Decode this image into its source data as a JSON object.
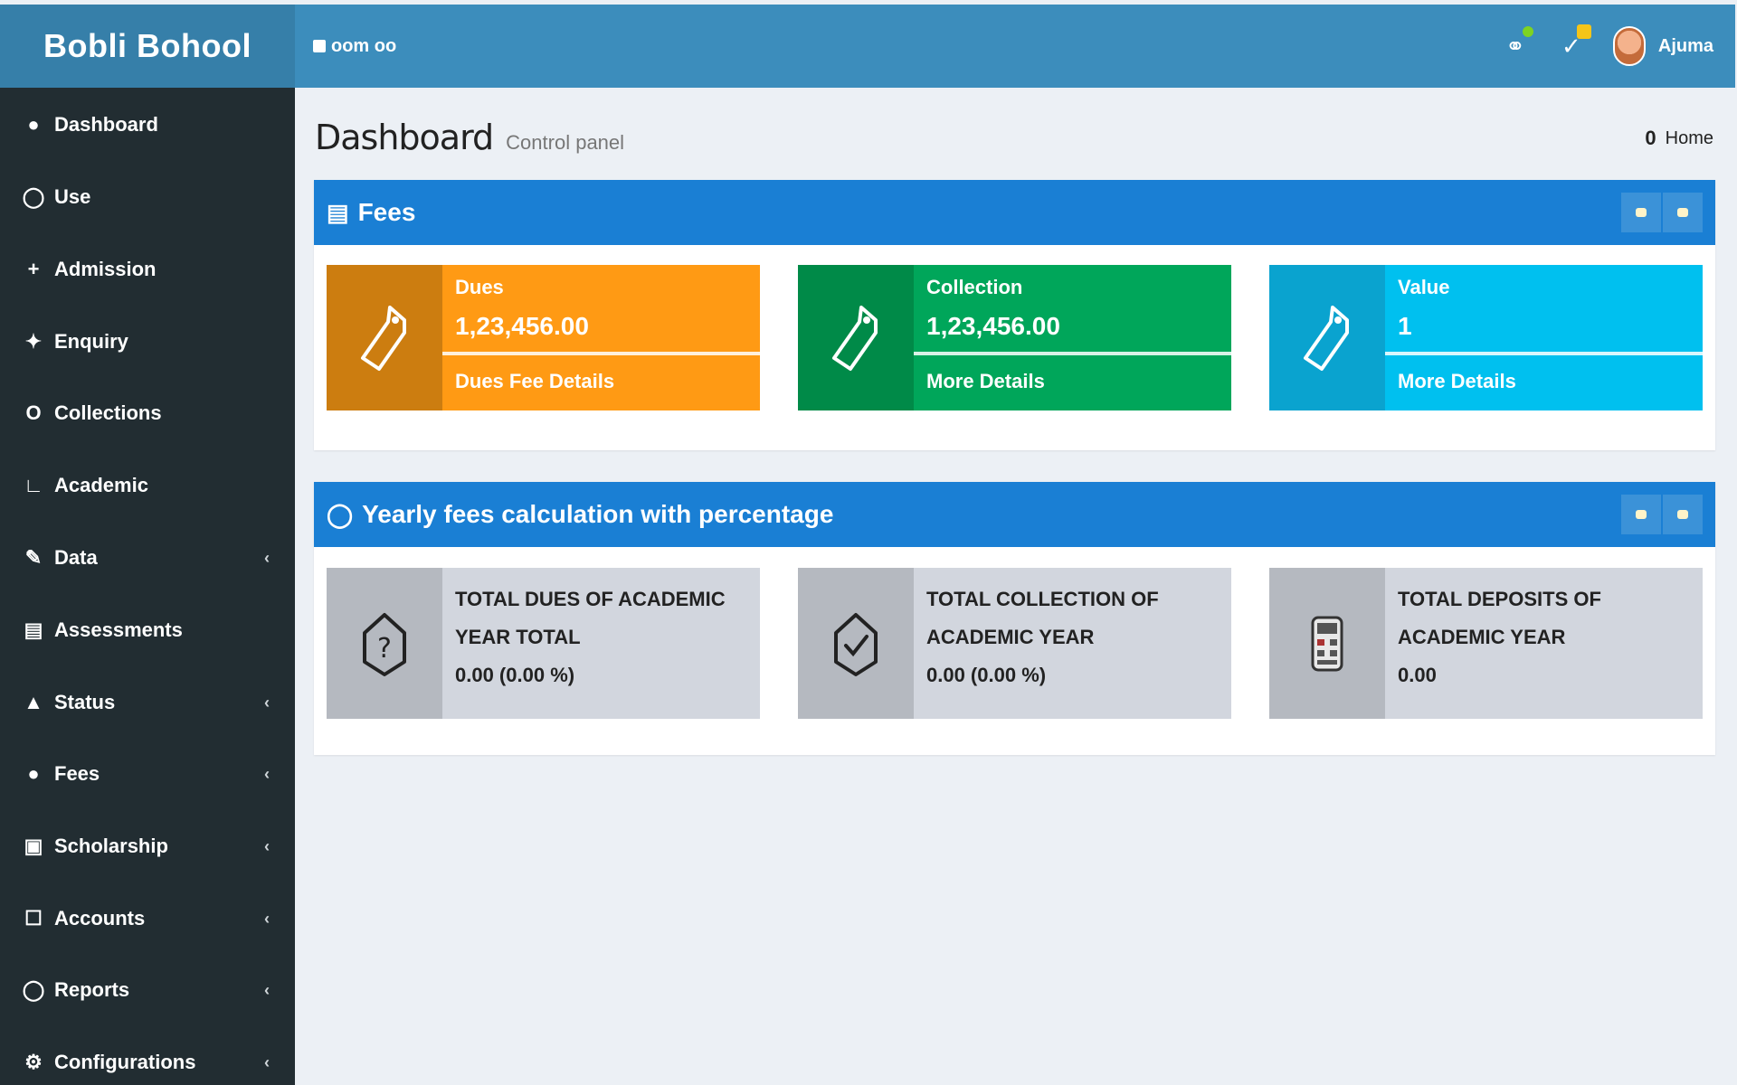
{
  "app": {
    "brand": "Bobli Bohool",
    "menu_label": "oom oo"
  },
  "header": {
    "user_name": "Ajuma",
    "icons": [
      "bell-icon",
      "flag-icon"
    ],
    "colors": {
      "bar": "#3c8dbc",
      "brand_bg": "#367fa9",
      "dot_green": "#7ed321",
      "badge_yellow": "#f5c518"
    }
  },
  "sidebar": {
    "items": [
      {
        "label": "Dashboard",
        "icon": "dashboard-icon",
        "caret": false
      },
      {
        "label": "Use",
        "icon": "user-icon",
        "caret": false
      },
      {
        "label": "Admission",
        "icon": "plus-icon",
        "caret": false
      },
      {
        "label": "Enquiry",
        "icon": "enquiry-icon",
        "caret": false
      },
      {
        "label": "Collections",
        "icon": "circle-icon",
        "caret": false
      },
      {
        "label": "Academic",
        "icon": "academic-icon",
        "caret": false
      },
      {
        "label": "Data",
        "icon": "pencil-icon",
        "caret": true
      },
      {
        "label": "Assessments",
        "icon": "clipboard-icon",
        "caret": false
      },
      {
        "label": "Status",
        "icon": "lock-icon",
        "caret": true
      },
      {
        "label": "Fees",
        "icon": "money-icon",
        "caret": true
      },
      {
        "label": "Scholarship",
        "icon": "book-icon",
        "caret": true
      },
      {
        "label": "Accounts",
        "icon": "accounts-icon",
        "caret": true
      },
      {
        "label": "Reports",
        "icon": "report-icon",
        "caret": true
      },
      {
        "label": "Configurations",
        "icon": "settings-icon",
        "caret": true
      }
    ],
    "colors": {
      "bg": "#222d32"
    }
  },
  "page": {
    "title": "Dashboard",
    "subtitle": "Control panel",
    "crumb_icon": "0",
    "crumb_label": "Home"
  },
  "fees_box": {
    "title": "Fees",
    "tiles": [
      {
        "label": "Dues",
        "value": "1,23,456.00",
        "footer": "Dues Fee Details",
        "icon": "tag-icon",
        "color_main": "#ff9a14",
        "color_icon": "#cc7d10"
      },
      {
        "label": "Collection",
        "value": "1,23,456.00",
        "footer": "More Details",
        "icon": "tag-icon",
        "color_main": "#00a65a",
        "color_icon": "#008a48"
      },
      {
        "label": "Value",
        "value": "1",
        "footer": "More Details",
        "icon": "tag-icon",
        "color_main": "#00c0ef",
        "color_icon": "#0aa3cf"
      }
    ]
  },
  "status_box": {
    "title": "Yearly fees calculation with percentage",
    "tiles": [
      {
        "line1": "TOTAL DUES OF ACADEMIC YEAR TOTAL",
        "line2": "0.00 (0.00 %)",
        "icon": "question-icon"
      },
      {
        "line1": "TOTAL COLLECTION OF ACADEMIC YEAR",
        "line2": "0.00 (0.00 %)",
        "icon": "check-icon"
      },
      {
        "line1": "TOTAL DEPOSITS OF ACADEMIC YEAR",
        "line2": "0.00",
        "icon": "calculator-icon"
      }
    ]
  }
}
